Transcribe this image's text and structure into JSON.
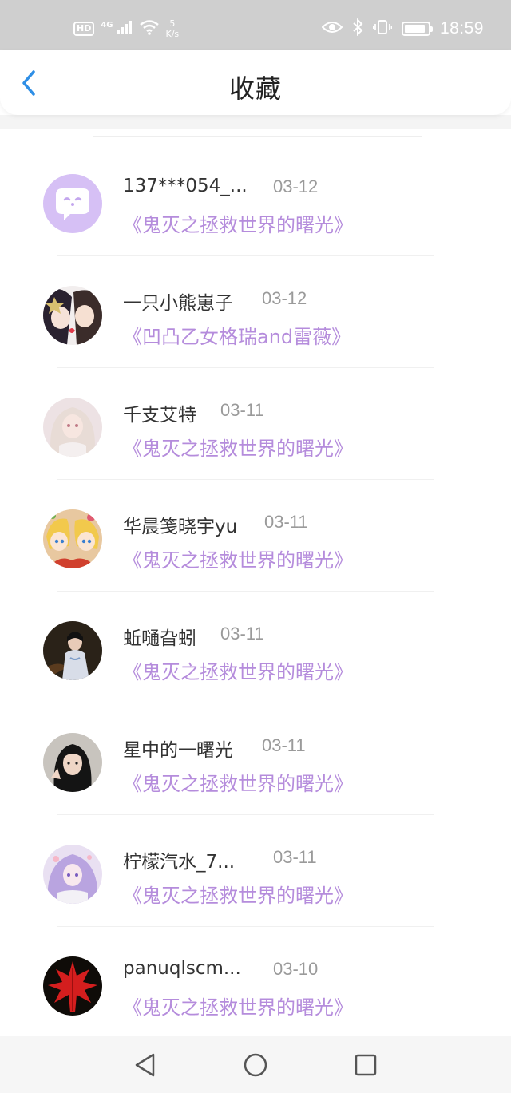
{
  "status_bar": {
    "hd": "HD",
    "network": "4G",
    "speed_value": "5",
    "speed_unit": "K/s",
    "time": "18:59",
    "battery_level": 0.9
  },
  "header": {
    "title": "收藏",
    "back_icon": "chevron-left-icon"
  },
  "colors": {
    "accent_blue": "#2f8fe6",
    "title_purple": "#b58cdc",
    "date_gray": "#9a9a9a",
    "name_text": "#333333"
  },
  "favorites": [
    {
      "name": "137***054_...",
      "date": "03-12",
      "title": "《鬼灭之拯救世界的曙光》",
      "avatar": "default-chat-avatar"
    },
    {
      "name": "一只小熊崽子",
      "date": "03-12",
      "title": "《凹凸乙女格瑞and雷薇》",
      "avatar": "anime-duo-avatar"
    },
    {
      "name": "千支艾特",
      "date": "03-11",
      "title": "《鬼灭之拯救世界的曙光》",
      "avatar": "white-hair-anime-avatar"
    },
    {
      "name": "华晨笺晓宇yu",
      "date": "03-11",
      "title": "《鬼灭之拯救世界的曙光》",
      "avatar": "twins-anime-avatar"
    },
    {
      "name": "蚯嗵旮蚓",
      "date": "03-11",
      "title": "《鬼灭之拯救世界的曙光》",
      "avatar": "qipao-photo-avatar"
    },
    {
      "name": "星中的一曙光",
      "date": "03-11",
      "title": "《鬼灭之拯救世界的曙光》",
      "avatar": "girl-photo-avatar"
    },
    {
      "name": "柠檬汽水_7...",
      "date": "03-11",
      "title": "《鬼灭之拯救世界的曙光》",
      "avatar": "purple-hair-anime-avatar"
    },
    {
      "name": "panuqlscm...",
      "date": "03-10",
      "title": "《鬼灭之拯救世界的曙光》",
      "avatar": "red-maple-leaf-avatar"
    }
  ],
  "navbar": {
    "back": "back-triangle-icon",
    "home": "home-circle-icon",
    "recents": "recents-square-icon"
  }
}
